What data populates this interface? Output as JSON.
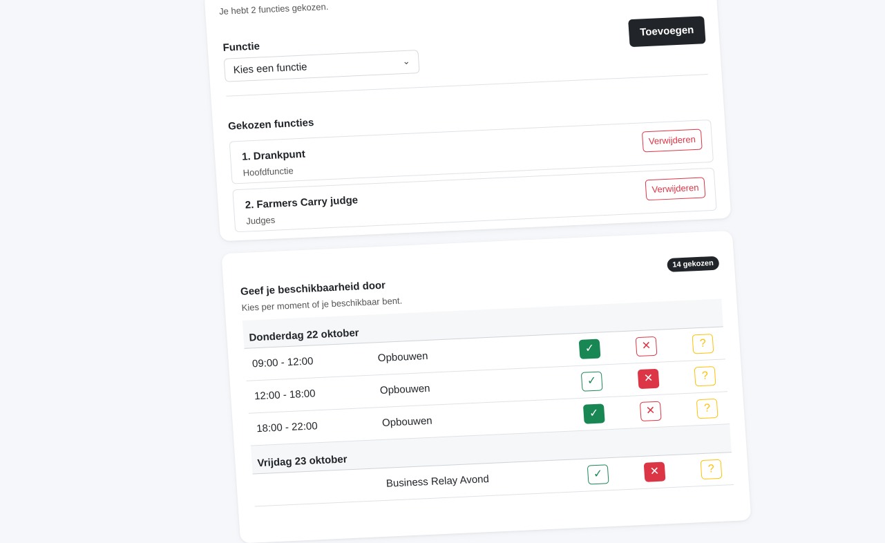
{
  "functions_card": {
    "subtitle": "Je hebt 2 functies gekozen.",
    "field_label": "Functie",
    "select_value": "Kies een functie",
    "add_button": "Toevoegen",
    "selected_title": "Gekozen functies",
    "items": [
      {
        "name": "1. Drankpunt",
        "sub": "Hoofdfunctie",
        "remove": "Verwijderen"
      },
      {
        "name": "2. Farmers Carry judge",
        "sub": "Judges",
        "remove": "Verwijderen"
      }
    ]
  },
  "availability_card": {
    "title": "Geef je beschikbaarheid door",
    "subtitle": "Kies per moment of je beschikbaar bent.",
    "badge": "14 gekozen",
    "days": [
      {
        "label": "Donderdag 22 oktober",
        "slots": [
          {
            "time": "09:00 - 12:00",
            "task": "Opbouwen",
            "state": "yes"
          },
          {
            "time": "12:00 - 18:00",
            "task": "Opbouwen",
            "state": "no"
          },
          {
            "time": "18:00 - 22:00",
            "task": "Opbouwen",
            "state": "yes"
          }
        ]
      },
      {
        "label": "Vrijdag 23 oktober",
        "slots": [
          {
            "time": "",
            "task": "Business Relay Avond",
            "state": "no"
          }
        ]
      }
    ],
    "icons": {
      "yes": "✓",
      "no": "✕",
      "maybe": "?"
    }
  },
  "colors": {
    "success": "#198754",
    "danger": "#dc3545",
    "warning": "#ffc107",
    "dark": "#212529"
  }
}
